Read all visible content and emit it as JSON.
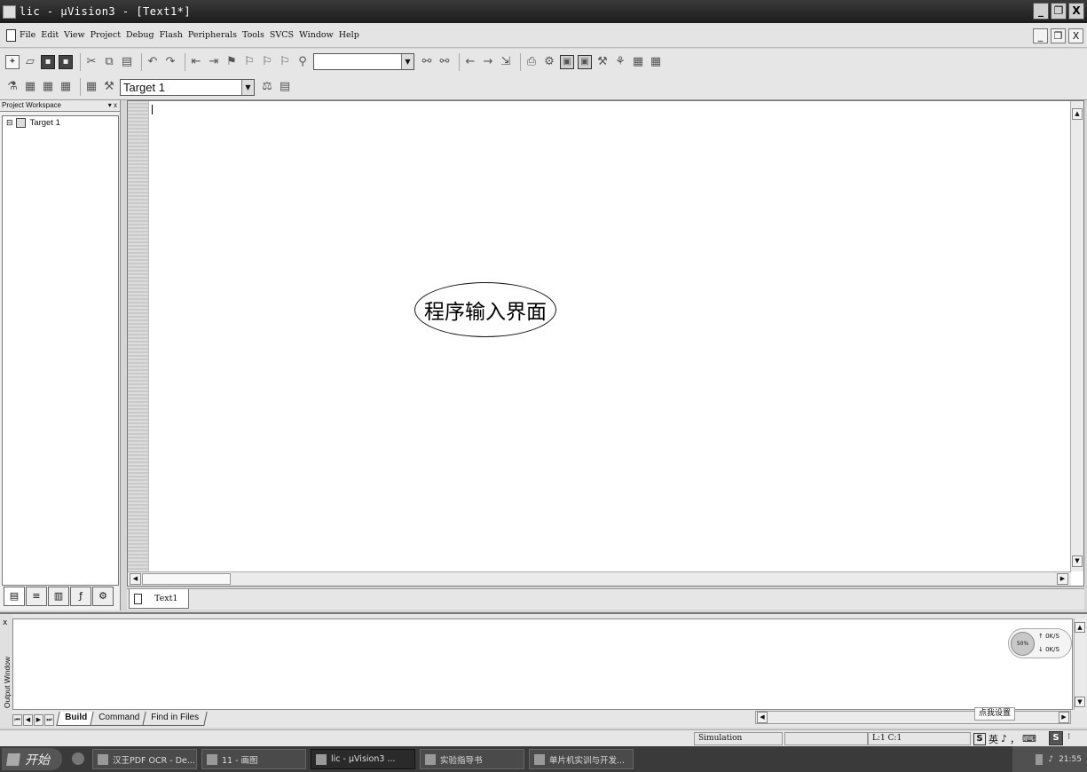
{
  "window": {
    "title": "lic - µVision3 - [Text1*]",
    "controls": [
      "_",
      "❐",
      "X"
    ]
  },
  "menubar": {
    "items": [
      "File",
      "Edit",
      "View",
      "Project",
      "Debug",
      "Flash",
      "Peripherals",
      "Tools",
      "SVCS",
      "Window",
      "Help"
    ],
    "mdi_controls": [
      "_",
      "❐",
      "X"
    ]
  },
  "toolbar2": {
    "target_select": "Target 1"
  },
  "workspace": {
    "header": "Project Workspace",
    "header_controls": "▾ x",
    "tree": [
      {
        "expand": "⊟",
        "label": "Target 1"
      }
    ]
  },
  "editor": {
    "annotation": "程序输入界面"
  },
  "doc_tabs": [
    {
      "label": "Text1"
    }
  ],
  "output": {
    "side_label": "Output Window",
    "close": "x",
    "tabs": [
      "Build",
      "Command",
      "Find in Files"
    ],
    "net_widget": {
      "percent": "50%",
      "up": "0K/S",
      "down": "0K/S"
    },
    "ime_tip": "点我设置"
  },
  "statusbar": {
    "mode": "Simulation",
    "position": "L:1 C:1",
    "ime": [
      "S",
      "英",
      "♪",
      "，",
      "⌨"
    ]
  },
  "taskbar": {
    "start": "开始",
    "tasks": [
      {
        "label": "汉王PDF OCR - De...",
        "active": false
      },
      {
        "label": "11 - 画图",
        "active": false
      },
      {
        "label": "lic - µVision3 ...",
        "active": true
      },
      {
        "label": "实验指导书",
        "active": false
      },
      {
        "label": "单片机实训与开发...",
        "active": false
      }
    ],
    "clock": "21:55"
  }
}
